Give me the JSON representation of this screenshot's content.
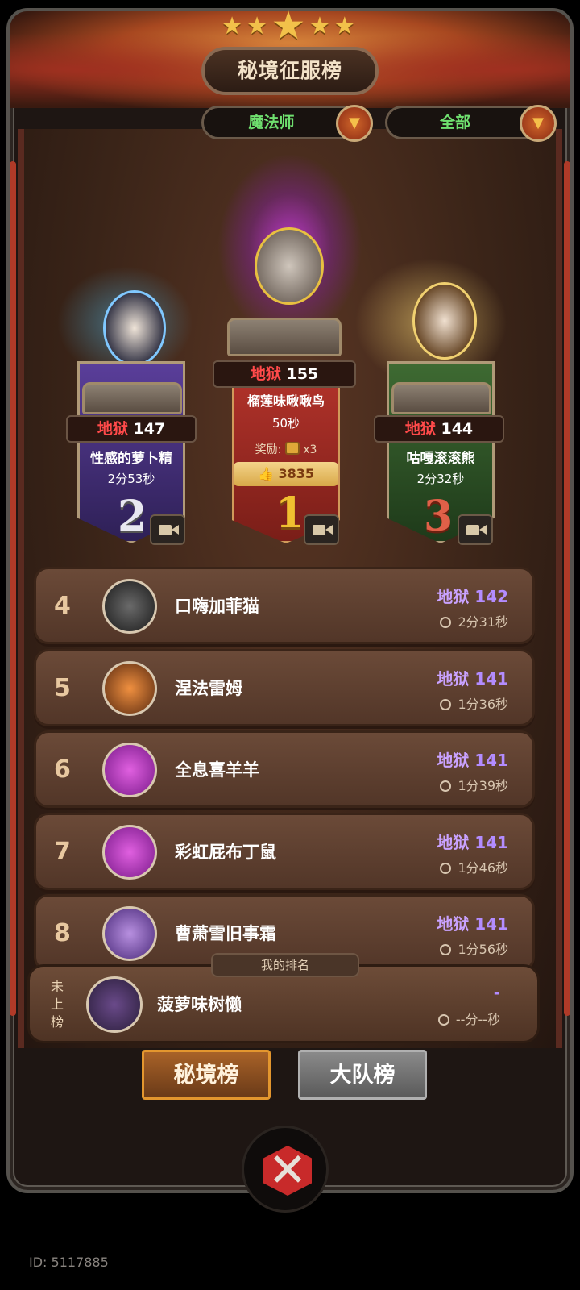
{
  "header": {
    "title": "秘境征服榜",
    "stars": [
      "★",
      "★",
      "★",
      "★",
      "★"
    ]
  },
  "filters": {
    "class_value": "魔法师",
    "scope_value": "全部",
    "dropdown_glyph": "▼"
  },
  "podium": {
    "first": {
      "rank": "1",
      "difficulty": "地狱",
      "level": "155",
      "name": "榴莲味啾啾鸟",
      "time": "50秒",
      "reward_label": "奖励:",
      "reward_count": "x3",
      "likes": "3835"
    },
    "second": {
      "rank": "2",
      "difficulty": "地狱",
      "level": "147",
      "name": "性感的萝卜精",
      "time": "2分53秒"
    },
    "third": {
      "rank": "3",
      "difficulty": "地狱",
      "level": "144",
      "name": "咕嘎滚滚熊",
      "time": "2分32秒"
    }
  },
  "ranking": [
    {
      "rank": "4",
      "name": "口嗨加菲猫",
      "difficulty": "地狱",
      "level": "142",
      "time": "2分31秒"
    },
    {
      "rank": "5",
      "name": "涅法雷姆",
      "difficulty": "地狱",
      "level": "141",
      "time": "1分36秒"
    },
    {
      "rank": "6",
      "name": "全息喜羊羊",
      "difficulty": "地狱",
      "level": "141",
      "time": "1分39秒"
    },
    {
      "rank": "7",
      "name": "彩虹屁布丁鼠",
      "difficulty": "地狱",
      "level": "141",
      "time": "1分46秒"
    },
    {
      "rank": "8",
      "name": "曹萧雪旧事霜",
      "difficulty": "地狱",
      "level": "141",
      "time": "1分56秒"
    }
  ],
  "my_rank": {
    "tag": "我的排名",
    "rank_text_1": "未",
    "rank_text_2": "上",
    "rank_text_3": "榜",
    "name": "菠萝味树懒",
    "score": "-",
    "time": "--分--秒"
  },
  "tabs": {
    "secret": "秘境榜",
    "team": "大队榜"
  },
  "close_glyph": "✕",
  "user_id": "ID: 5117885",
  "colors": {
    "difficulty_red": "#ff4a4a",
    "score_purple": "#b38cff",
    "filter_green": "#6fe06f",
    "gold": "#f2c14a"
  }
}
